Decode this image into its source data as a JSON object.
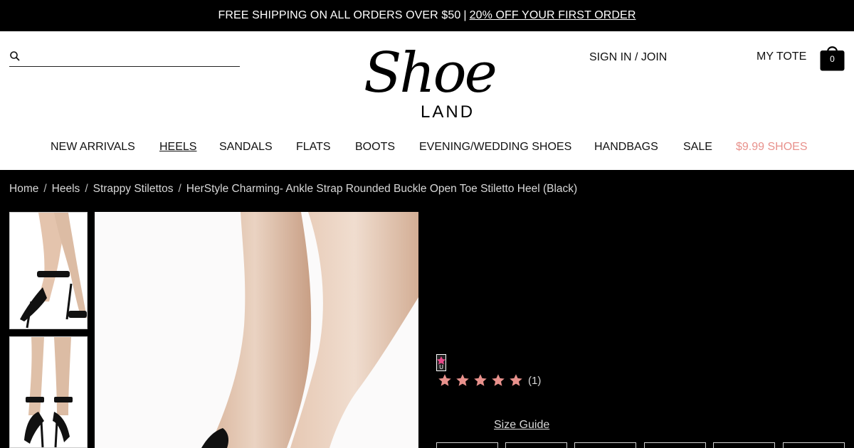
{
  "promo": {
    "text": "FREE SHIPPING ON ALL ORDERS OVER $50",
    "separator": "|",
    "link": "20% OFF YOUR FIRST ORDER"
  },
  "search": {
    "placeholder": ""
  },
  "logo": {
    "script": "Shoe",
    "sub": "LAND"
  },
  "account": {
    "signin": "SIGN IN / JOIN",
    "tote": "MY TOTE",
    "tote_count": "0"
  },
  "nav": [
    {
      "label": "NEW ARRIVALS"
    },
    {
      "label": "HEELS"
    },
    {
      "label": "SANDALS"
    },
    {
      "label": "FLATS"
    },
    {
      "label": "BOOTS"
    },
    {
      "label": "EVENING/WEDDING SHOES"
    },
    {
      "label": "HANDBAGS"
    },
    {
      "label": "SALE"
    },
    {
      "label": "$9.99 SHOES"
    }
  ],
  "breadcrumb": [
    "Home",
    "Heels",
    "Strappy Stilettos",
    "HerStyle Charming- Ankle Strap Rounded Buckle Open Toe Stiletto Heel (Black)"
  ],
  "breadcrumb_separator": "/",
  "product": {
    "rating_value": 5,
    "rating_max": 5,
    "review_count": "(1)",
    "size_guide": "Size Guide"
  },
  "colors": {
    "accent_sale": "#e8918c",
    "star": "#e8918c",
    "background": "#000000"
  },
  "icons": {
    "search": "search-icon",
    "bag": "shopping-bag-icon",
    "star": "star-icon"
  }
}
